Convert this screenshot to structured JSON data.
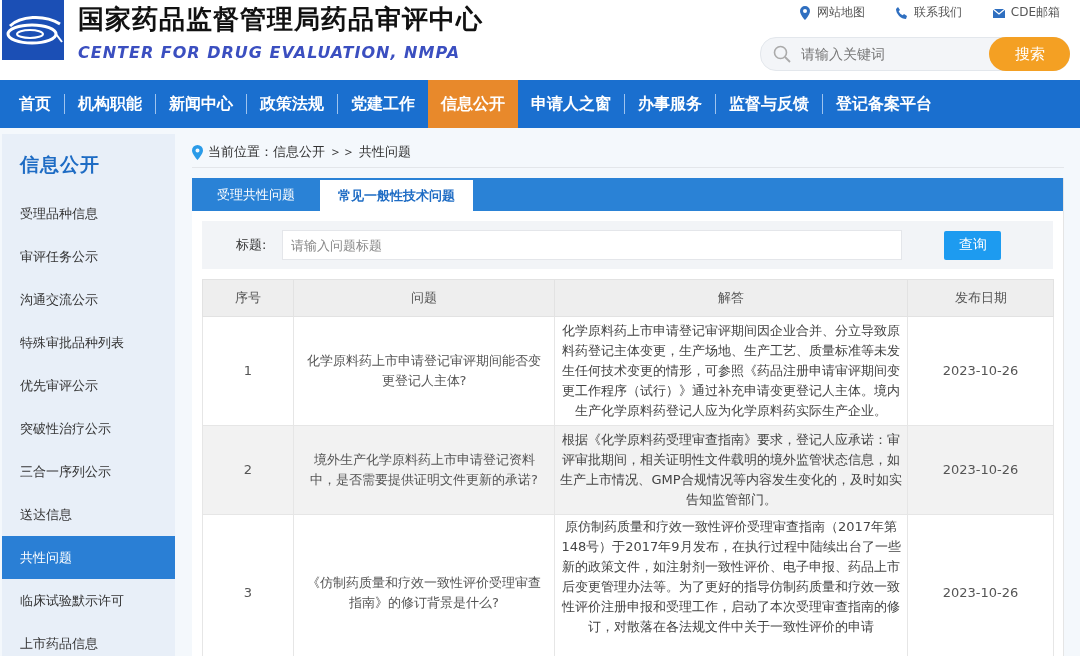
{
  "header": {
    "title": "国家药品监督管理局药品审评中心",
    "subtitle": "CENTER FOR DRUG EVALUATION, NMPA",
    "links": [
      {
        "kind": "pin",
        "label": "网站地图"
      },
      {
        "kind": "phone",
        "label": "联系我们"
      },
      {
        "kind": "mail",
        "label": "CDE邮箱"
      }
    ],
    "search": {
      "placeholder": "请输入关键词",
      "button": "搜索"
    }
  },
  "nav": [
    {
      "label": "首页",
      "selected": false
    },
    {
      "label": "机构职能",
      "selected": false
    },
    {
      "label": "新闻中心",
      "selected": false
    },
    {
      "label": "政策法规",
      "selected": false
    },
    {
      "label": "党建工作",
      "selected": false
    },
    {
      "label": "信息公开",
      "selected": true
    },
    {
      "label": "申请人之窗",
      "selected": false
    },
    {
      "label": "办事服务",
      "selected": false
    },
    {
      "label": "监督与反馈",
      "selected": false
    },
    {
      "label": "登记备案平台",
      "selected": false
    }
  ],
  "sidebar": {
    "title": "信息公开",
    "items": [
      {
        "label": "受理品种信息",
        "selected": false
      },
      {
        "label": "审评任务公示",
        "selected": false
      },
      {
        "label": "沟通交流公示",
        "selected": false
      },
      {
        "label": "特殊审批品种列表",
        "selected": false
      },
      {
        "label": "优先审评公示",
        "selected": false
      },
      {
        "label": "突破性治疗公示",
        "selected": false
      },
      {
        "label": "三合一序列公示",
        "selected": false
      },
      {
        "label": "送达信息",
        "selected": false
      },
      {
        "label": "共性问题",
        "selected": true
      },
      {
        "label": "临床试验默示许可",
        "selected": false
      },
      {
        "label": "上市药品信息",
        "selected": false
      }
    ]
  },
  "breadcrumb": "当前位置：信息公开 ＞＞ 共性问题",
  "tabs": [
    {
      "label": "受理共性问题",
      "selected": false
    },
    {
      "label": "常见一般性技术问题",
      "selected": true
    }
  ],
  "filter": {
    "label": "标题:",
    "placeholder": "请输入问题标题",
    "button": "查询"
  },
  "table": {
    "columns": [
      "序号",
      "问题",
      "解答",
      "发布日期"
    ],
    "rows": [
      {
        "no": "1",
        "question": "化学原料药上市申请登记审评期间能否变更登记人主体?",
        "answer": "化学原料药上市申请登记审评期间因企业合并、分立导致原料药登记主体变更，生产场地、生产工艺、质量标准等未发生任何技术变更的情形，可参照《药品注册申请审评期间变更工作程序（试行）》通过补充申请变更登记人主体。境内生产化学原料药登记人应为化学原料药实际生产企业。",
        "date": "2023-10-26"
      },
      {
        "no": "2",
        "question": "境外生产化学原料药上市申请登记资料中，是否需要提供证明文件更新的承诺?",
        "answer": "根据《化学原料药受理审查指南》要求，登记人应承诺：审评审批期间，相关证明性文件载明的境外监管状态信息，如生产上市情况、GMP合规情况等内容发生变化的，及时如实告知监管部门。",
        "date": "2023-10-26"
      },
      {
        "no": "3",
        "question": "《仿制药质量和疗效一致性评价受理审查指南》的修订背景是什么?",
        "answer": "原仿制药质量和疗效一致性评价受理审查指南（2017年第148号）于2017年9月发布，在执行过程中陆续出台了一些新的政策文件，如注射剂一致性评价、电子申报、药品上市后变更管理办法等。为了更好的指导仿制药质量和疗效一致性评价注册申报和受理工作，启动了本次受理审查指南的修订，对散落在各法规文件中关于一致性评价的申请",
        "date": "2023-10-26"
      }
    ]
  }
}
